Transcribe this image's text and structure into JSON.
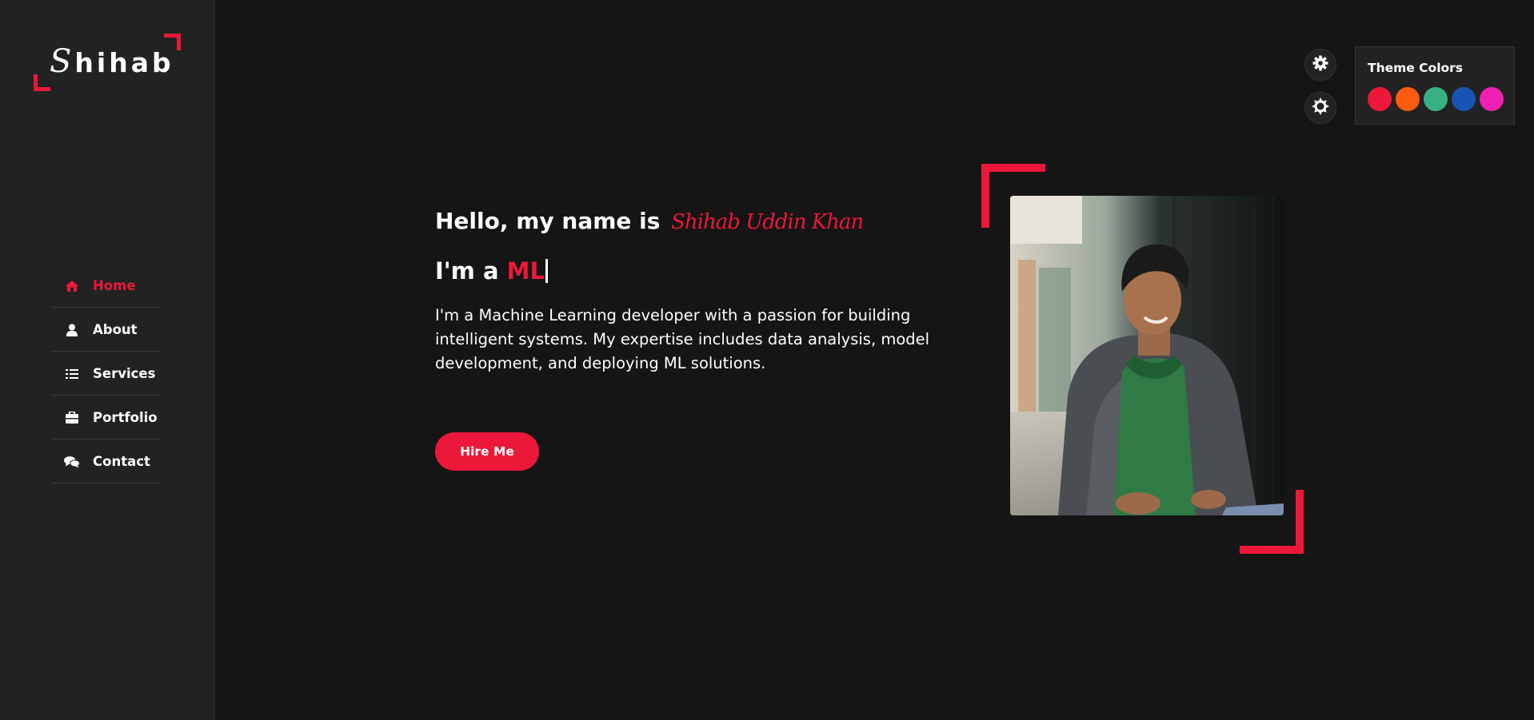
{
  "brand": {
    "logo_initial": "S",
    "logo_rest": "hihab",
    "accent_color": "#ec1839"
  },
  "nav": {
    "items": [
      {
        "label": "Home",
        "icon": "home-icon",
        "active": true
      },
      {
        "label": "About",
        "icon": "user-icon",
        "active": false
      },
      {
        "label": "Services",
        "icon": "list-icon",
        "active": false
      },
      {
        "label": "Portfolio",
        "icon": "briefcase-icon",
        "active": false
      },
      {
        "label": "Contact",
        "icon": "comments-icon",
        "active": false
      }
    ]
  },
  "hero": {
    "greeting": "Hello, my name is",
    "name": "Shihab Uddin Khan",
    "role_prefix": "I'm a",
    "role_word": "ML",
    "bio": "I'm a Machine Learning developer with a passion for building intelligent systems. My expertise includes data analysis, model development, and deploying ML solutions.",
    "cta_label": "Hire Me"
  },
  "settings": {
    "settings_icon": "gear-icon",
    "theme_toggle_icon": "sun-icon"
  },
  "theme_panel": {
    "title": "Theme Colors",
    "colors": [
      "#ec1839",
      "#fa5b0f",
      "#37b182",
      "#1854b4",
      "#f021b2"
    ]
  }
}
